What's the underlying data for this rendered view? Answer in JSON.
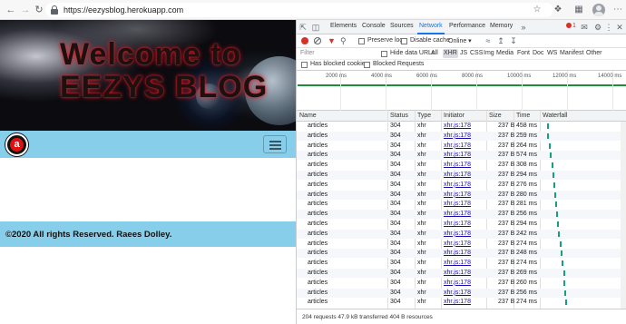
{
  "browser": {
    "url_scheme": "https://",
    "url_host": "eezysblog.herokuapp.com"
  },
  "page": {
    "hero_title": "Welcome to\nEEZYS BLOG",
    "logo_letter": "a",
    "footer_text": "©2020 All rights Reserved. Raees Dolley."
  },
  "devtools": {
    "tabs": [
      "Elements",
      "Console",
      "Sources",
      "Network",
      "Performance",
      "Memory"
    ],
    "active_tab": "Network",
    "error_count": "1",
    "toolbar": {
      "preserve_log": "Preserve log",
      "disable_cache": "Disable cache",
      "throttle": "Online"
    },
    "filter": {
      "placeholder": "Filter",
      "hide_data_urls": "Hide data URLs",
      "types": [
        "All",
        "XHR",
        "JS",
        "CSS",
        "Img",
        "Media",
        "Font",
        "Doc",
        "WS",
        "Manifest",
        "Other"
      ],
      "active_type": "XHR",
      "has_blocked_cookies": "Has blocked cookies",
      "blocked_requests": "Blocked Requests"
    },
    "overview_ticks": [
      "2000 ms",
      "4000 ms",
      "6000 ms",
      "8000 ms",
      "10000 ms",
      "12000 ms",
      "14000 ms"
    ],
    "columns": [
      "Name",
      "Status",
      "Type",
      "Initiator",
      "Size",
      "Time",
      "Waterfall"
    ],
    "requests": [
      {
        "name": "articles",
        "status": "304",
        "type": "xhr",
        "initiator": "xhr.js:178",
        "size": "237 B",
        "time": "458 ms",
        "wf": 0.05
      },
      {
        "name": "articles",
        "status": "304",
        "type": "xhr",
        "initiator": "xhr.js:178",
        "size": "237 B",
        "time": "259 ms",
        "wf": 0.06
      },
      {
        "name": "articles",
        "status": "304",
        "type": "xhr",
        "initiator": "xhr.js:178",
        "size": "237 B",
        "time": "264 ms",
        "wf": 0.08
      },
      {
        "name": "articles",
        "status": "304",
        "type": "xhr",
        "initiator": "xhr.js:178",
        "size": "237 B",
        "time": "574 ms",
        "wf": 0.09
      },
      {
        "name": "articles",
        "status": "304",
        "type": "xhr",
        "initiator": "xhr.js:178",
        "size": "237 B",
        "time": "308 ms",
        "wf": 0.11
      },
      {
        "name": "articles",
        "status": "304",
        "type": "xhr",
        "initiator": "xhr.js:178",
        "size": "237 B",
        "time": "294 ms",
        "wf": 0.12
      },
      {
        "name": "articles",
        "status": "304",
        "type": "xhr",
        "initiator": "xhr.js:178",
        "size": "237 B",
        "time": "276 ms",
        "wf": 0.13
      },
      {
        "name": "articles",
        "status": "304",
        "type": "xhr",
        "initiator": "xhr.js:178",
        "size": "237 B",
        "time": "280 ms",
        "wf": 0.14
      },
      {
        "name": "articles",
        "status": "304",
        "type": "xhr",
        "initiator": "xhr.js:178",
        "size": "237 B",
        "time": "281 ms",
        "wf": 0.15
      },
      {
        "name": "articles",
        "status": "304",
        "type": "xhr",
        "initiator": "xhr.js:178",
        "size": "237 B",
        "time": "256 ms",
        "wf": 0.17
      },
      {
        "name": "articles",
        "status": "304",
        "type": "xhr",
        "initiator": "xhr.js:178",
        "size": "237 B",
        "time": "294 ms",
        "wf": 0.18
      },
      {
        "name": "articles",
        "status": "304",
        "type": "xhr",
        "initiator": "xhr.js:178",
        "size": "237 B",
        "time": "242 ms",
        "wf": 0.19
      },
      {
        "name": "articles",
        "status": "304",
        "type": "xhr",
        "initiator": "xhr.js:178",
        "size": "237 B",
        "time": "274 ms",
        "wf": 0.21
      },
      {
        "name": "articles",
        "status": "304",
        "type": "xhr",
        "initiator": "xhr.js:178",
        "size": "237 B",
        "time": "248 ms",
        "wf": 0.22
      },
      {
        "name": "articles",
        "status": "304",
        "type": "xhr",
        "initiator": "xhr.js:178",
        "size": "237 B",
        "time": "274 ms",
        "wf": 0.23
      },
      {
        "name": "articles",
        "status": "304",
        "type": "xhr",
        "initiator": "xhr.js:178",
        "size": "237 B",
        "time": "269 ms",
        "wf": 0.25
      },
      {
        "name": "articles",
        "status": "304",
        "type": "xhr",
        "initiator": "xhr.js:178",
        "size": "237 B",
        "time": "260 ms",
        "wf": 0.26
      },
      {
        "name": "articles",
        "status": "304",
        "type": "xhr",
        "initiator": "xhr.js:178",
        "size": "237 B",
        "time": "256 ms",
        "wf": 0.27
      },
      {
        "name": "articles",
        "status": "304",
        "type": "xhr",
        "initiator": "xhr.js:178",
        "size": "237 B",
        "time": "274 ms",
        "wf": 0.28
      }
    ],
    "status_bar": "204 requests  47.9 kB transferred  404 B resources",
    "colors": {
      "accent": "#1a73e8",
      "waterfall": "#13a07c",
      "banner": "#87ceeb",
      "record": "#d93025"
    }
  }
}
